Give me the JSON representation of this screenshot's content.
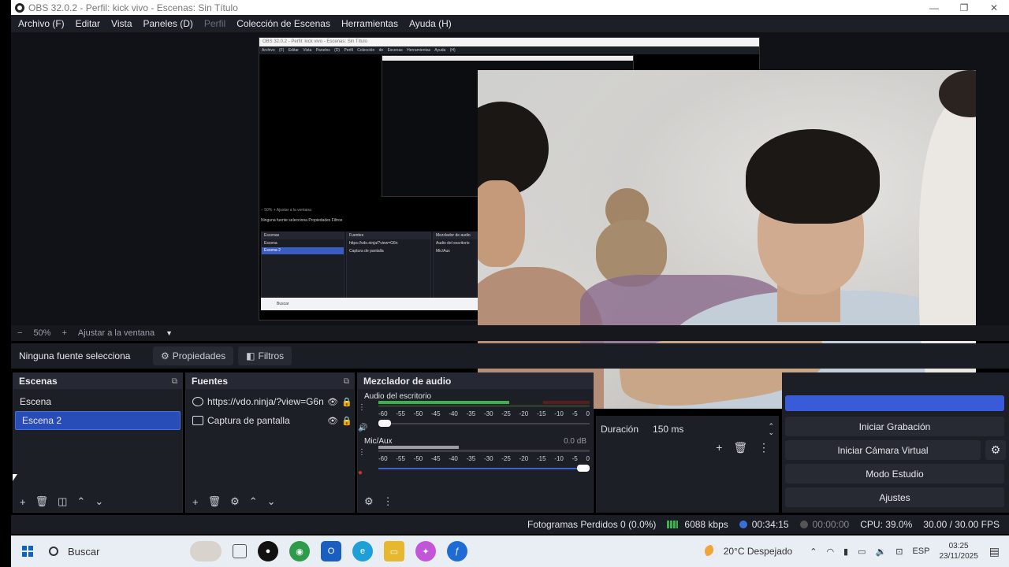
{
  "window": {
    "title": "OBS 32.0.2 - Perfil: kick vivo - Escenas: Sin Título",
    "minimize": "—",
    "maximize": "❐",
    "close": "✕"
  },
  "menu": [
    "Archivo (F)",
    "Editar",
    "Vista",
    "Paneles (D)",
    "Perfil",
    "Colección de Escenas",
    "Herramientas",
    "Ayuda (H)"
  ],
  "nested": {
    "title": "OBS 32.0.2 - Perfil: kick vivo - Escenas: Sin Título",
    "menu": "Archivo (F)  Editar  Vista  Paneles (D)  Perfil  Colección de Escenas  Herramientas  Ayuda (H)",
    "zoom": "−  50%  +  Ajustar a la ventana",
    "props": "Ninguna fuente selecciona   Propiedades   Filtros",
    "scenes_head": "Escenas",
    "scene1": "Escena",
    "scene2": "Escena 2",
    "sources_head": "Fuentes",
    "src1": "https://vdo.ninja/?view=G6n",
    "src2": "Captura de pantalla",
    "mixer_head": "Mezclador de audio",
    "ch1": "Audio del escritorio",
    "ch2": "Mic/Aux",
    "task": "Buscar"
  },
  "zoom": {
    "minus": "−",
    "value": "50%",
    "plus": "+",
    "fit": "Ajustar a la ventana",
    "arrow": "▼"
  },
  "props": {
    "none": "Ninguna fuente selecciona",
    "properties": "Propiedades",
    "filters": "Filtros"
  },
  "scenes": {
    "title": "Escenas",
    "items": [
      "Escena",
      "Escena 2"
    ],
    "selected": 1
  },
  "sources": {
    "title": "Fuentes",
    "items": [
      {
        "label": "https://vdo.ninja/?view=G6n",
        "icon": "browser-source-icon"
      },
      {
        "label": "Captura de pantalla",
        "icon": "display-capture-icon"
      }
    ]
  },
  "mixer": {
    "title": "Mezclador de audio",
    "channels": [
      {
        "name": "Audio del escritorio",
        "db": "",
        "level": 0.62
      },
      {
        "name": "Mic/Aux",
        "db": "0.0 dB",
        "level": 0.38
      }
    ],
    "scale": [
      "-60",
      "-55",
      "-50",
      "-45",
      "-40",
      "-35",
      "-30",
      "-25",
      "-20",
      "-15",
      "-10",
      "-5",
      "0"
    ]
  },
  "transitions": {
    "duration_label": "Duración",
    "duration_value": "150 ms"
  },
  "controls": {
    "record": "Iniciar Grabación",
    "virtualcam": "Iniciar Cámara Virtual",
    "studio": "Modo Estudio",
    "settings": "Ajustes"
  },
  "status": {
    "dropped": "Fotogramas Perdidos 0 (0.0%)",
    "bitrate": "6088 kbps",
    "stream_time": "00:34:15",
    "rec_time": "00:00:00",
    "cpu": "CPU: 39.0%",
    "fps": "30.00 / 30.00 FPS"
  },
  "taskbar": {
    "search": "Buscar",
    "weather": "20°C  Despejado",
    "lang": "ESP",
    "time": "03:25",
    "date": "23/11/2025"
  },
  "colors": {
    "accent": "#284cb8",
    "stream_live": "#3a5bd7",
    "meter_green": "#3cb24a"
  }
}
